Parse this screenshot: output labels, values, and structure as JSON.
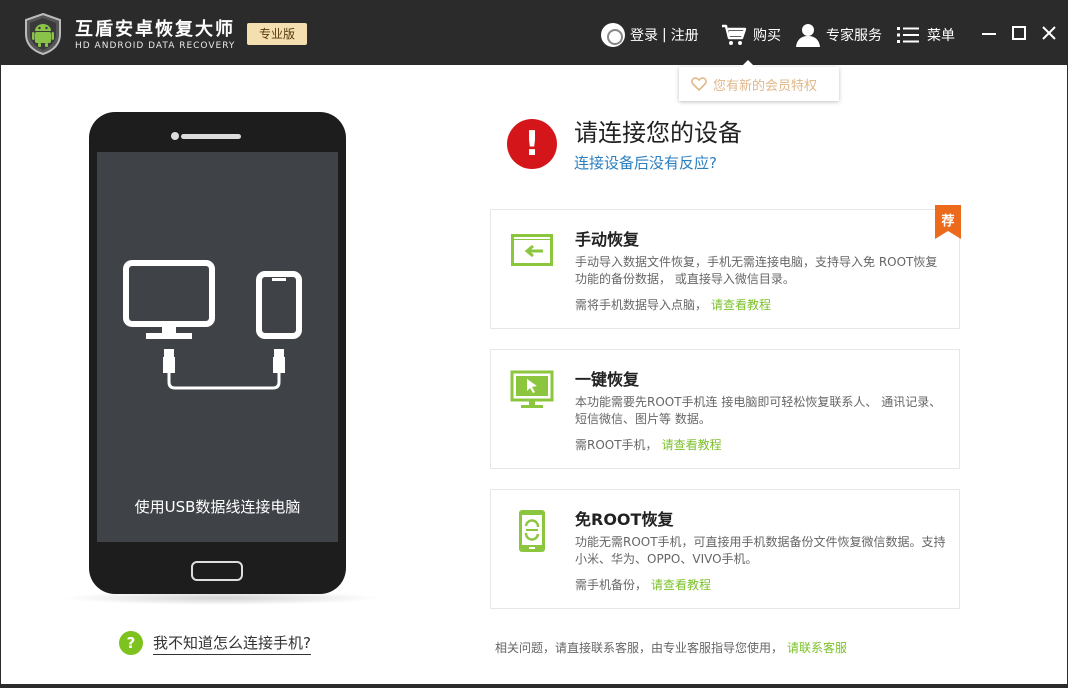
{
  "app": {
    "title": "互盾安卓恢复大师",
    "subtitle": "HD ANDROID DATA RECOVERY",
    "edition": "专业版"
  },
  "nav": {
    "login": "登录",
    "separator": "|",
    "register": "注册",
    "buy": "购买",
    "expert": "专家服务",
    "menu": "菜单"
  },
  "tooltip": {
    "text": "您有新的会员特权"
  },
  "phone": {
    "caption": "使用USB数据线连接电脑"
  },
  "help_link": {
    "icon": "?",
    "text": "我不知道怎么连接手机?"
  },
  "status": {
    "icon": "!",
    "heading": "请连接您的设备",
    "subheading": "连接设备后没有反应?"
  },
  "cards": [
    {
      "title": "手动恢复",
      "desc": "手动导入数据文件恢复，手机无需连接电脑，支持导入免 ROOT恢复功能的备份数据，  或直接导入微信目录。",
      "foot": "需将手机数据导入点脑，",
      "link": "请查看教程",
      "badge": "荐",
      "icon": "import-icon"
    },
    {
      "title": "一键恢复",
      "desc": "本功能需要先ROOT手机连 接电脑即可轻松恢复联系人、 通讯记录、短信微信、图片等 数据。",
      "foot": "需ROOT手机，",
      "link": "请查看教程",
      "icon": "monitor-click-icon"
    },
    {
      "title": "免ROOT恢复",
      "desc": "功能无需ROOT手机，可直接用手机数据备份文件恢复微信数据。支持小米、华为、OPPO、VIVO手机。",
      "foot": "需手机备份，",
      "link": "请查看教程",
      "icon": "phone-sync-icon"
    }
  ],
  "footer": {
    "text": "相关问题，请直接联系客服，由专业客服指导您使用，",
    "link": "请联系客服"
  },
  "colors": {
    "titlebar": "#2b2b2b",
    "accent_green": "#7cc12a",
    "alert_red": "#d4161b",
    "link_blue": "#2a7fc1",
    "badge_orange": "#ec6a1c"
  }
}
